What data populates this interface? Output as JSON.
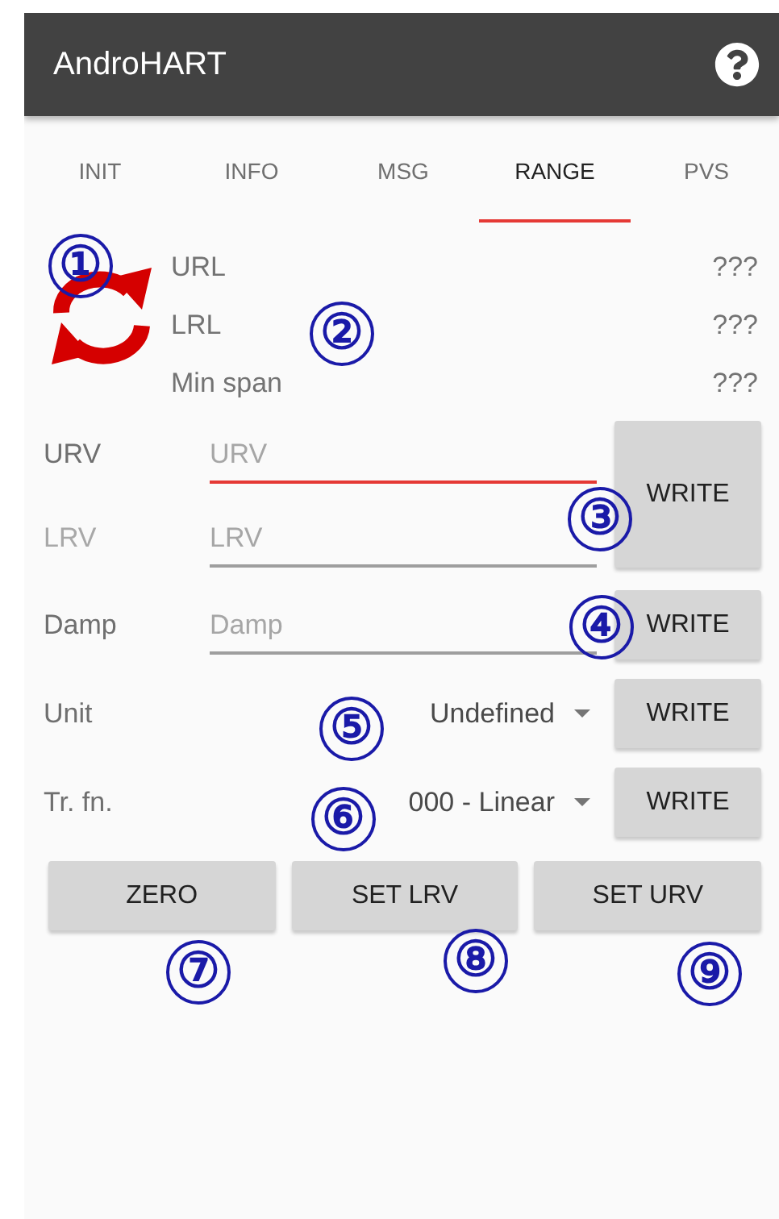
{
  "app_bar": {
    "title": "AndroHART"
  },
  "tabs": [
    {
      "label": "INIT",
      "selected": false
    },
    {
      "label": "INFO",
      "selected": false
    },
    {
      "label": "MSG",
      "selected": false
    },
    {
      "label": "RANGE",
      "selected": true
    },
    {
      "label": "PVS",
      "selected": false
    }
  ],
  "limits": [
    {
      "label": "URL",
      "value": "???"
    },
    {
      "label": "LRL",
      "value": "???"
    },
    {
      "label": "Min span",
      "value": "???"
    }
  ],
  "range_fields": [
    {
      "label": "URV",
      "placeholder": "URV",
      "focused": true,
      "disabled": false
    },
    {
      "label": "LRV",
      "placeholder": "LRV",
      "focused": false,
      "disabled": true
    }
  ],
  "range_button": "WRITE",
  "damp": {
    "label": "Damp",
    "placeholder": "Damp",
    "focused": false,
    "disabled": false,
    "button": "WRITE"
  },
  "selects": [
    {
      "label": "Unit",
      "value": "Undefined",
      "button": "WRITE"
    },
    {
      "label": "Tr. fn.",
      "value": "000 - Linear",
      "button": "WRITE"
    }
  ],
  "actions": [
    "ZERO",
    "SET LRV",
    "SET URV"
  ],
  "markers": [
    "①",
    "②",
    "③",
    "④",
    "⑤",
    "⑥",
    "⑦",
    "⑧",
    "⑨"
  ]
}
